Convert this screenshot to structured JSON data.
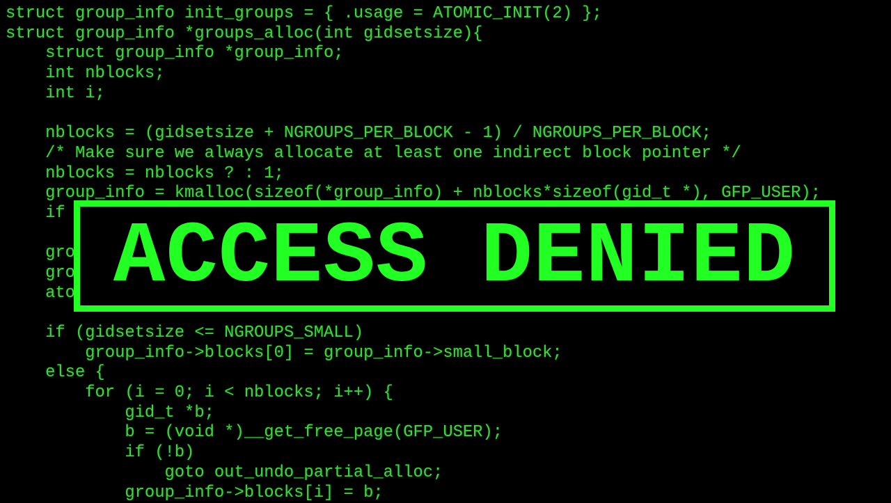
{
  "code_lines": [
    "struct group_info init_groups = { .usage = ATOMIC_INIT(2) };",
    "struct group_info *groups_alloc(int gidsetsize){",
    "    struct group_info *group_info;",
    "    int nblocks;",
    "    int i;",
    "",
    "    nblocks = (gidsetsize + NGROUPS_PER_BLOCK - 1) / NGROUPS_PER_BLOCK;",
    "    /* Make sure we always allocate at least one indirect block pointer */",
    "    nblocks = nblocks ? : 1;",
    "    group_info = kmalloc(sizeof(*group_info) + nblocks*sizeof(gid_t *), GFP_USER);",
    "    if",
    "",
    "    gro",
    "    gro",
    "    ato",
    "",
    "    if (gidsetsize <= NGROUPS_SMALL)",
    "        group_info->blocks[0] = group_info->small_block;",
    "    else {",
    "        for (i = 0; i < nblocks; i++) {",
    "            gid_t *b;",
    "            b = (void *)__get_free_page(GFP_USER);",
    "            if (!b)",
    "                goto out_undo_partial_alloc;",
    "            group_info->blocks[i] = b;"
  ],
  "overlay": {
    "title": "ACCESS DENIED",
    "color": "#22ff22"
  },
  "code_color": "#3ad83a"
}
